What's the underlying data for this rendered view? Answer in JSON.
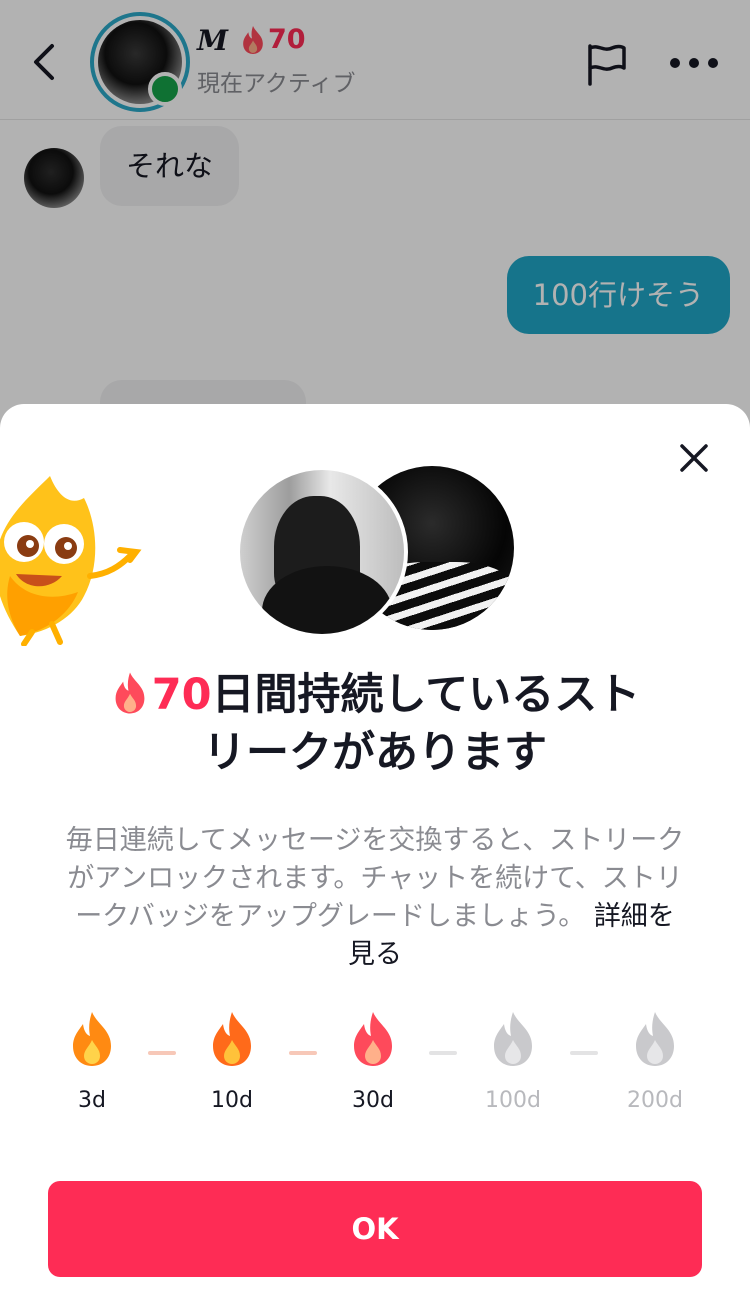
{
  "header": {
    "name": "M",
    "streak_count": "70",
    "status": "現在アクティブ"
  },
  "messages": [
    {
      "from": "them",
      "text": "それな"
    },
    {
      "from": "me",
      "text": "100行けそう"
    }
  ],
  "sheet": {
    "title_streak": "70",
    "title_line1_rest": "日間持続しているスト",
    "title_line2": "リークがあります",
    "description": "毎日連続してメッセージを交換すると、ストリークがアンロックされます。チャットを続けて、ストリークバッジをアップグレードしましょう。",
    "details_link": "詳細を見る",
    "milestones": [
      {
        "label": "3d",
        "unlocked": true,
        "color": "#ff9a1f"
      },
      {
        "label": "10d",
        "unlocked": true,
        "color": "#ff7a1f"
      },
      {
        "label": "30d",
        "unlocked": true,
        "color": "#fe4a5b"
      },
      {
        "label": "100d",
        "unlocked": false,
        "color": "#c9c9cc"
      },
      {
        "label": "200d",
        "unlocked": false,
        "color": "#c9c9cc"
      }
    ],
    "ok_label": "OK"
  },
  "colors": {
    "accent": "#fe2c55",
    "outgoing_bubble": "#20a7c7",
    "online": "#16a34a"
  }
}
